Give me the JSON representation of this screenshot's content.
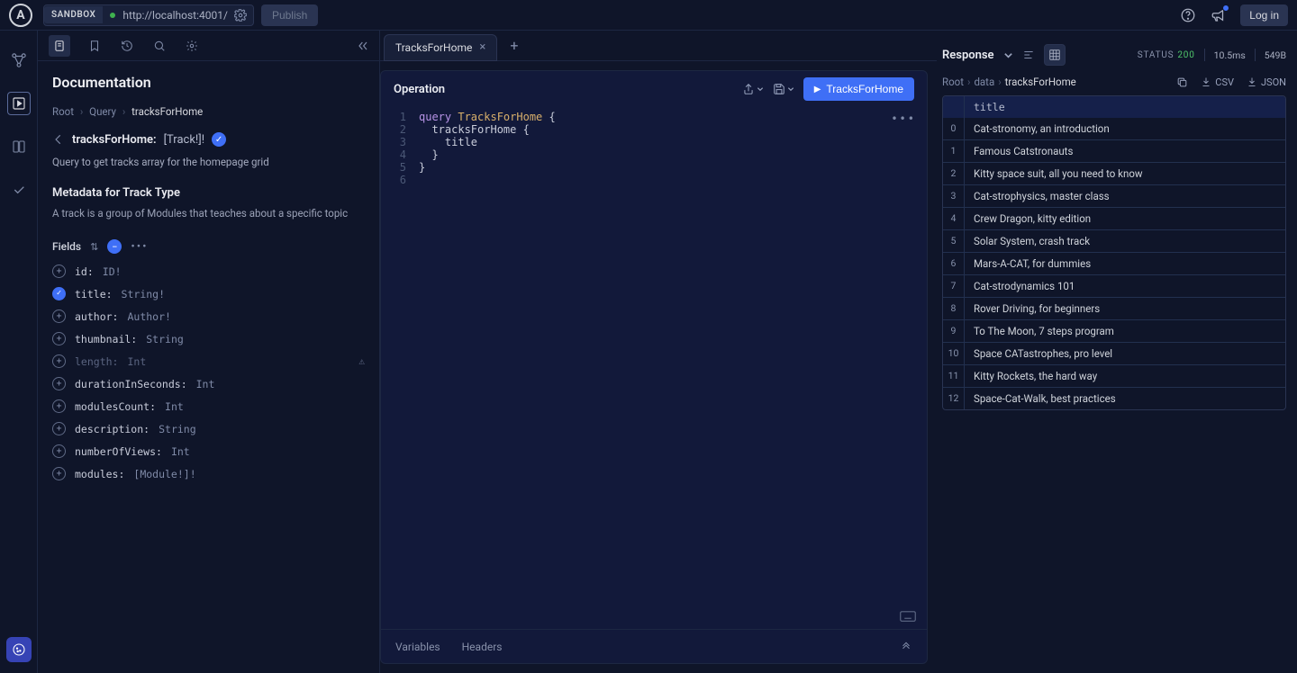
{
  "topbar": {
    "logo_letter": "A",
    "sandbox_label": "SANDBOX",
    "url": "http://localhost:4001/",
    "publish_label": "Publish",
    "login_label": "Log in"
  },
  "doc": {
    "title": "Documentation",
    "breadcrumb": {
      "root": "Root",
      "mid": "Query",
      "leaf": "tracksForHome"
    },
    "field_name": "tracksForHome:",
    "field_type": "[Track!]!",
    "description": "Query to get tracks array for the homepage grid",
    "meta_header": "Metadata for Track Type",
    "meta_desc": "A track is a group of Modules that teaches about a specific topic",
    "fields_label": "Fields",
    "fields": [
      {
        "name": "id:",
        "type": "ID!",
        "selected": false,
        "deprecated": false
      },
      {
        "name": "title:",
        "type": "String!",
        "selected": true,
        "deprecated": false
      },
      {
        "name": "author:",
        "type": "Author!",
        "selected": false,
        "deprecated": false
      },
      {
        "name": "thumbnail:",
        "type": "String",
        "selected": false,
        "deprecated": false
      },
      {
        "name": "length:",
        "type": "Int",
        "selected": false,
        "deprecated": true
      },
      {
        "name": "durationInSeconds:",
        "type": "Int",
        "selected": false,
        "deprecated": false
      },
      {
        "name": "modulesCount:",
        "type": "Int",
        "selected": false,
        "deprecated": false
      },
      {
        "name": "description:",
        "type": "String",
        "selected": false,
        "deprecated": false
      },
      {
        "name": "numberOfViews:",
        "type": "Int",
        "selected": false,
        "deprecated": false
      },
      {
        "name": "modules:",
        "type": "[Module!]!",
        "selected": false,
        "deprecated": false
      }
    ]
  },
  "operation": {
    "tab_label": "TracksForHome",
    "header": "Operation",
    "run_label": "TracksForHome",
    "code": {
      "l1_kw": "query",
      "l1_name": "TracksForHome",
      "l1_rest": " {",
      "l2": "  tracksForHome {",
      "l3": "    title",
      "l4": "  }",
      "l5": "}"
    },
    "footer_variables": "Variables",
    "footer_headers": "Headers"
  },
  "response": {
    "title": "Response",
    "status_label": "STATUS",
    "status_code": "200",
    "timing": "10.5ms",
    "size": "549B",
    "breadcrumb": {
      "root": "Root",
      "mid": "data",
      "leaf": "tracksForHome"
    },
    "export_csv": "CSV",
    "export_json": "JSON",
    "column": "title",
    "rows": [
      "Cat-stronomy, an introduction",
      "Famous Catstronauts",
      "Kitty space suit, all you need to know",
      "Cat-strophysics, master class",
      "Crew Dragon, kitty edition",
      "Solar System, crash track",
      "Mars-A-CAT, for dummies",
      "Cat-strodynamics 101",
      "Rover Driving, for beginners",
      "To The Moon, 7 steps program",
      "Space CATastrophes, pro level",
      "Kitty Rockets, the hard way",
      "Space-Cat-Walk, best practices"
    ]
  }
}
